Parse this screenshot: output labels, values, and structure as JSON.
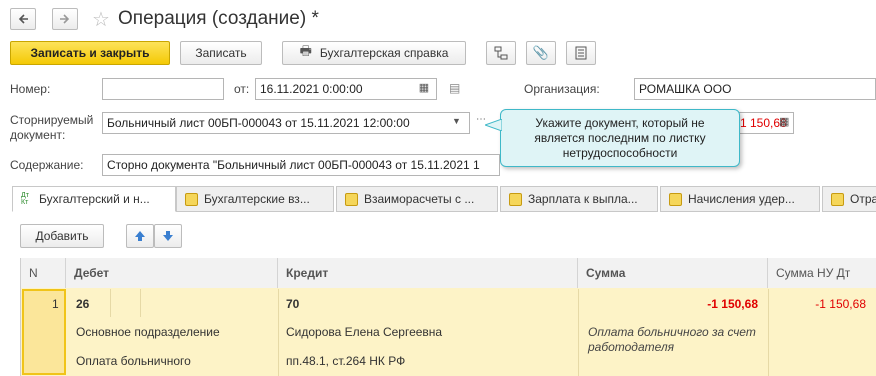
{
  "header": {
    "title": "Операция (создание) *",
    "back_icon": "arrow-left-icon",
    "forward_icon": "arrow-right-icon",
    "favorite_icon": "star-icon"
  },
  "toolbar": {
    "save_close_label": "Записать и закрыть",
    "save_label": "Записать",
    "report_label": "Бухгалтерская справка",
    "icons": [
      "structure-icon",
      "paperclip-icon",
      "document-list-icon"
    ]
  },
  "form": {
    "number_label": "Номер:",
    "number_value": "",
    "date_from_label": "от:",
    "date_value": "16.11.2021  0:00:00",
    "org_label": "Организация:",
    "org_value": "РОМАШКА ООО",
    "storno_label_1": "Сторнируемый",
    "storno_label_2": "документ:",
    "storno_value": "Больничный лист 00БП-000043 от 15.11.2021 12:00:00",
    "amount_value": "-1 150,68",
    "content_label": "Содержание:",
    "content_value": "Сторно документа \"Больничный лист 00БП-000043 от 15.11.2021 1"
  },
  "tooltip": {
    "text": "Укажите документ, который не является последним по листку нетрудоспособности"
  },
  "tabs": [
    {
      "label": "Бухгалтерский и н..."
    },
    {
      "label": "Бухгалтерские вз..."
    },
    {
      "label": "Взаиморасчеты с ..."
    },
    {
      "label": "Зарплата к выпла..."
    },
    {
      "label": "Начисления удер..."
    },
    {
      "label": "Отра"
    }
  ],
  "tab_icon_text": "Дт Кт",
  "table": {
    "add_label": "Добавить",
    "headers": {
      "n": "N",
      "debit": "Дебет",
      "credit": "Кредит",
      "sum": "Сумма",
      "sum_nu": "Сумма НУ Дт"
    },
    "row": {
      "n": "1",
      "debit_account": "26",
      "credit_account": "70",
      "sum": "-1 150,68",
      "sum_nu": "-1 150,68",
      "debit_sub1": "Основное подразделение",
      "credit_sub1": "Сидорова Елена Сергеевна",
      "content": "Оплата больничного за счет работодателя",
      "debit_sub2": "Оплата больничного",
      "credit_sub2": "пп.48.1, ст.264 НК РФ"
    }
  },
  "colors": {
    "accent_yellow": "#f4c905",
    "row_highlight": "#fdf3c7",
    "negative": "#e00000",
    "tooltip_bg": "#d9f3f5",
    "tooltip_border": "#3fb8c8"
  }
}
